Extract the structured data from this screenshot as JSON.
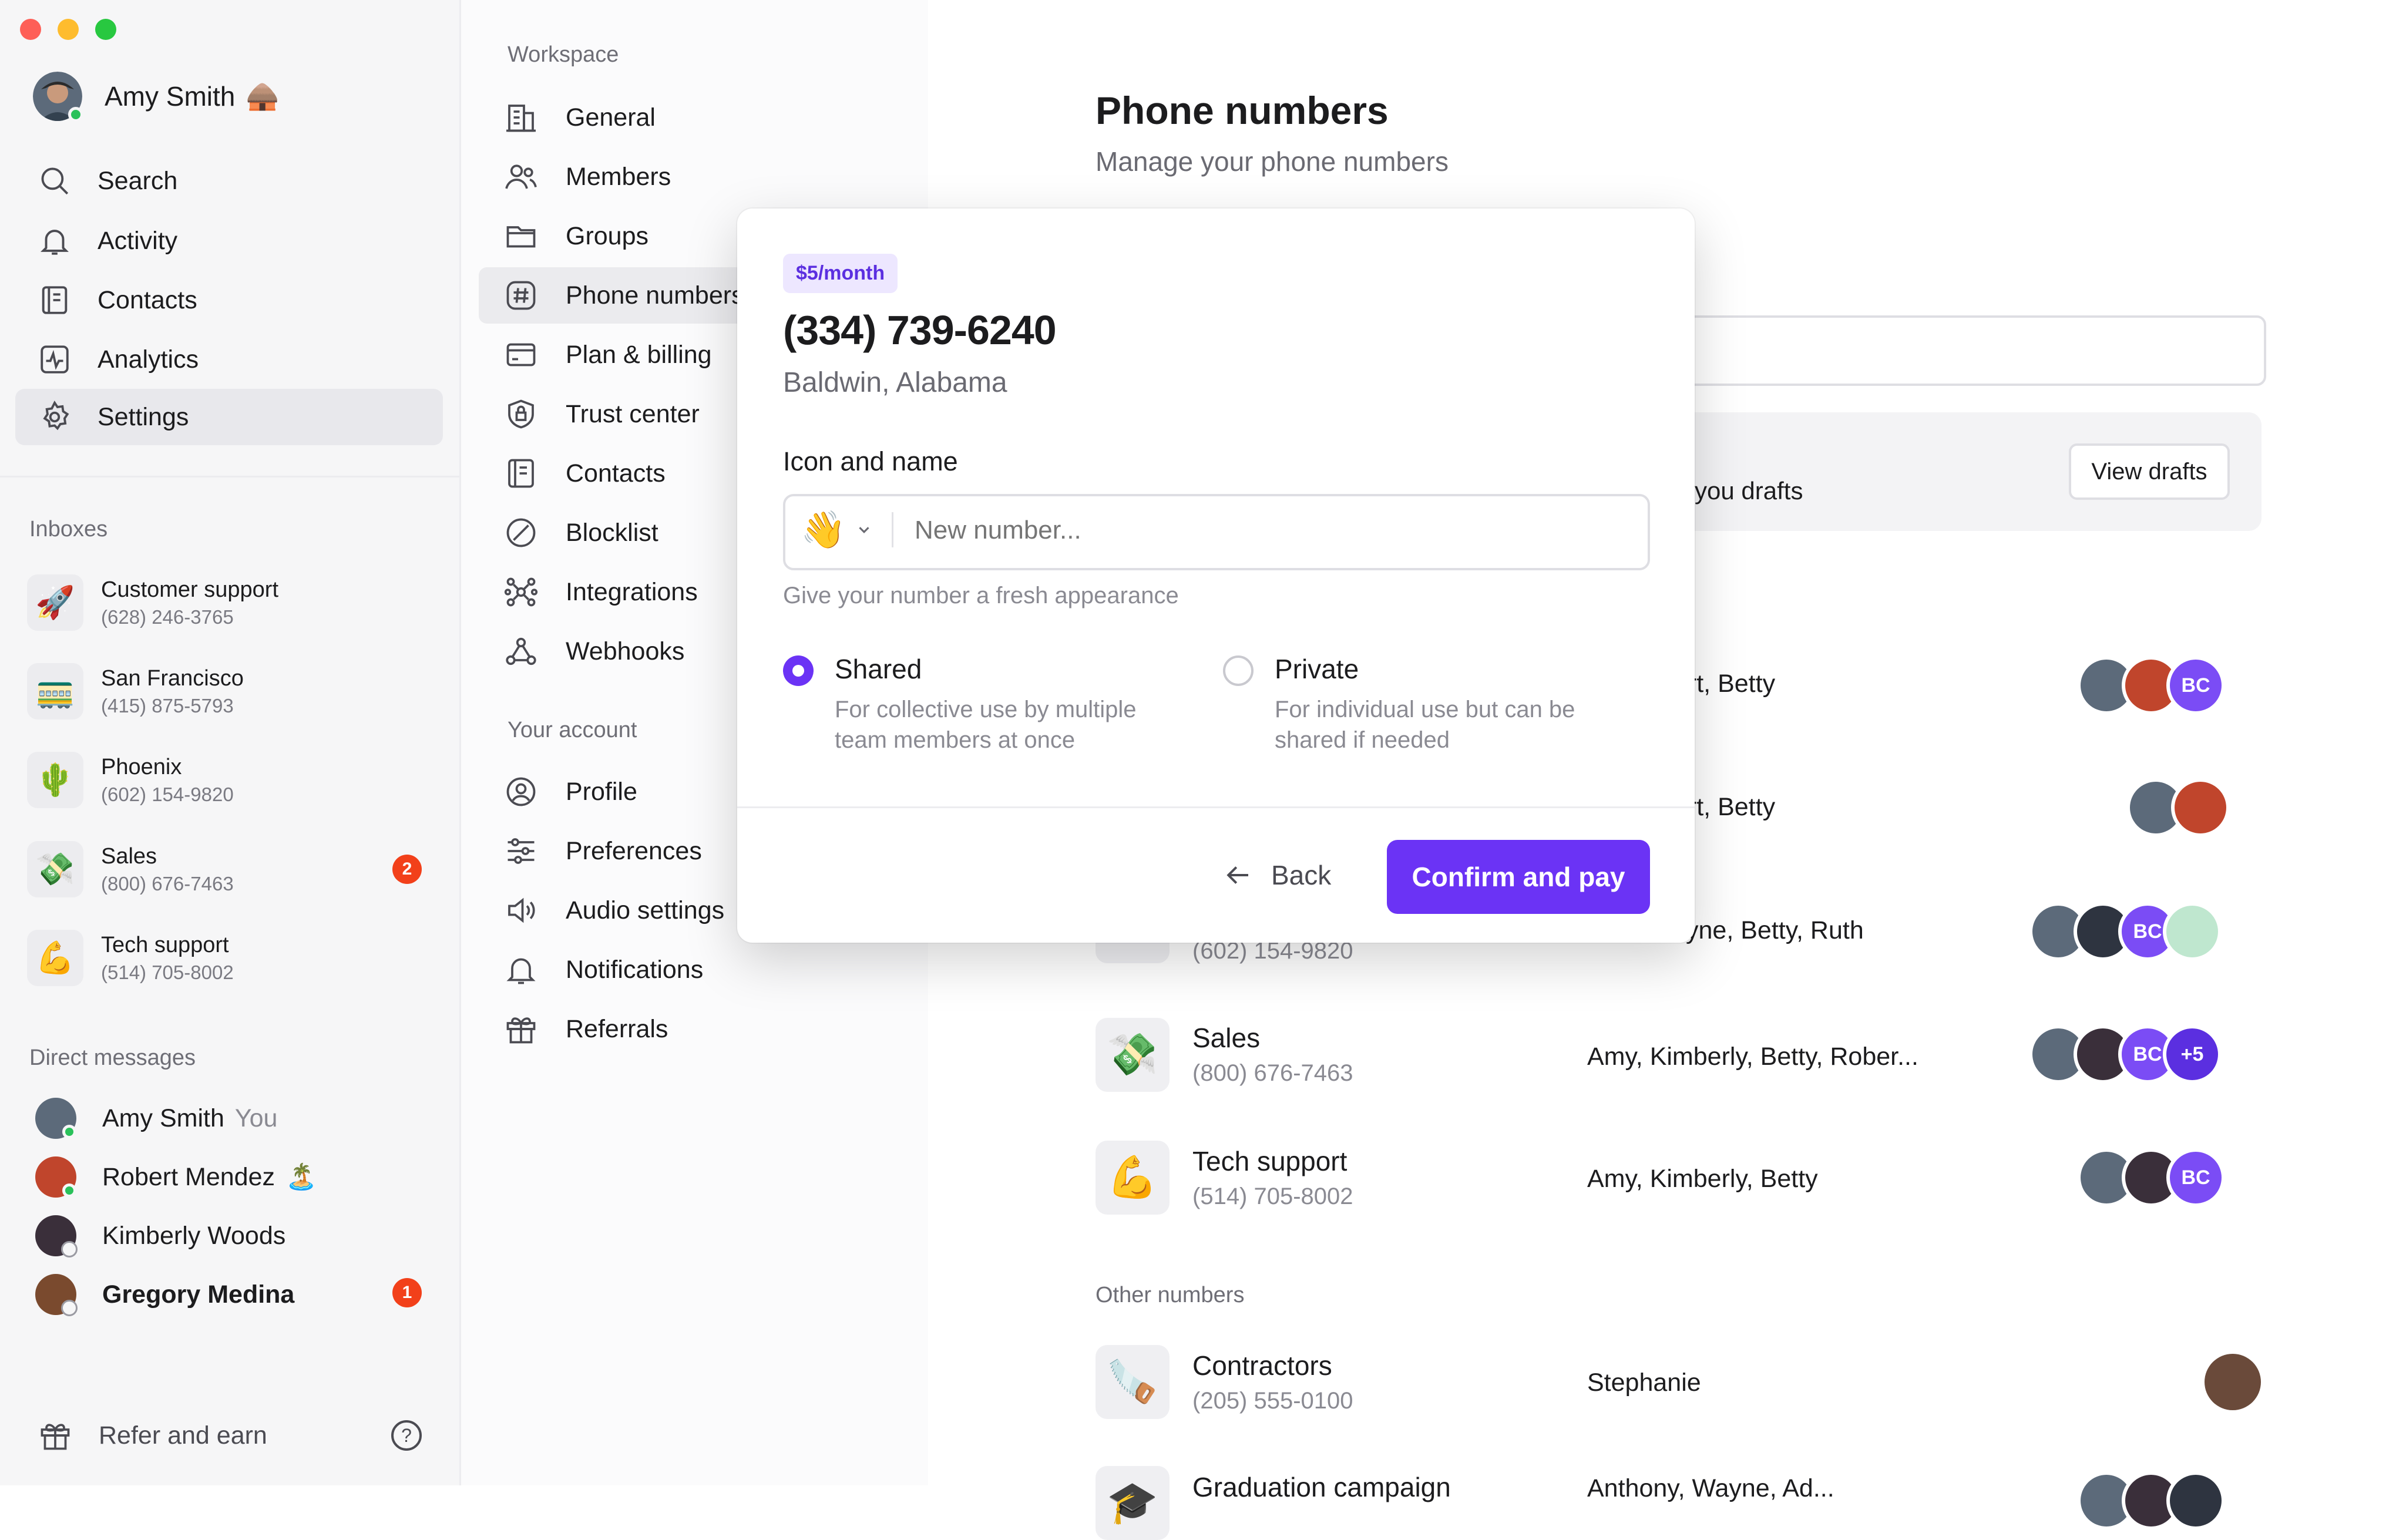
{
  "window": {
    "controls": [
      "close",
      "minimize",
      "maximize"
    ]
  },
  "user": {
    "name": "Amy Smith",
    "status_emoji": "🛖"
  },
  "sidebar": {
    "nav": [
      {
        "label": "Search",
        "icon": "search-icon"
      },
      {
        "label": "Activity",
        "icon": "bell-icon"
      },
      {
        "label": "Contacts",
        "icon": "contacts-icon"
      },
      {
        "label": "Analytics",
        "icon": "analytics-icon"
      },
      {
        "label": "Settings",
        "icon": "gear-icon",
        "active": true
      }
    ],
    "inboxes_label": "Inboxes",
    "inboxes": [
      {
        "emoji": "🚀",
        "name": "Customer support",
        "phone": "(628) 246-3765"
      },
      {
        "emoji": "🚃",
        "name": "San Francisco",
        "phone": "(415) 875-5793"
      },
      {
        "emoji": "🌵",
        "name": "Phoenix",
        "phone": "(602) 154-9820"
      },
      {
        "emoji": "💸",
        "name": "Sales",
        "phone": "(800) 676-7463",
        "badge": "2"
      },
      {
        "emoji": "💪",
        "name": "Tech support",
        "phone": "(514) 705-8002"
      }
    ],
    "dm_label": "Direct messages",
    "dms": [
      {
        "name": "Amy Smith",
        "suffix": "You"
      },
      {
        "name": "Robert Mendez",
        "suffix": "🏝️"
      },
      {
        "name": "Kimberly Woods",
        "suffix": ""
      },
      {
        "name": "Gregory Medina",
        "suffix": "",
        "badge": "1"
      }
    ],
    "refer": "Refer and earn"
  },
  "settings_nav": {
    "workspace_label": "Workspace",
    "workspace": [
      {
        "label": "General",
        "icon": "building-icon"
      },
      {
        "label": "Members",
        "icon": "members-icon"
      },
      {
        "label": "Groups",
        "icon": "folder-icon"
      },
      {
        "label": "Phone numbers",
        "icon": "hash-icon",
        "active": true
      },
      {
        "label": "Plan & billing",
        "icon": "credit-card-icon"
      },
      {
        "label": "Trust center",
        "icon": "shield-icon"
      },
      {
        "label": "Contacts",
        "icon": "contacts-icon"
      },
      {
        "label": "Blocklist",
        "icon": "block-icon"
      },
      {
        "label": "Integrations",
        "icon": "integrations-icon"
      },
      {
        "label": "Webhooks",
        "icon": "webhooks-icon"
      }
    ],
    "account_label": "Your account",
    "account": [
      {
        "label": "Profile",
        "icon": "profile-icon"
      },
      {
        "label": "Preferences",
        "icon": "sliders-icon"
      },
      {
        "label": "Audio settings",
        "icon": "speaker-icon"
      },
      {
        "label": "Notifications",
        "icon": "bell-icon"
      },
      {
        "label": "Referrals",
        "icon": "gift-icon"
      }
    ]
  },
  "main": {
    "title": "Phone numbers",
    "subtitle": "Manage your phone numbers",
    "drafts_text": "n you drafts",
    "view_drafts": "View drafts",
    "rows": [
      {
        "members": "ert, Betty",
        "avatars": [
          "A",
          "R",
          "BC"
        ]
      },
      {
        "members": "ert, Betty",
        "avatars": [
          "A",
          "R"
        ]
      },
      {
        "name": "",
        "phone": "(602) 154-9820",
        "members": "Amy, Wayne, Betty, Ruth",
        "members_visible": "yne, Betty, Ruth",
        "avatars": [
          "A",
          "W",
          "BC",
          "R"
        ]
      },
      {
        "emoji": "💸",
        "name": "Sales",
        "phone": "(800) 676-7463",
        "members": "Amy, Kimberly, Betty, Rober...",
        "avatars": [
          "A",
          "K",
          "BC",
          "+5"
        ]
      },
      {
        "emoji": "💪",
        "name": "Tech support",
        "phone": "(514) 705-8002",
        "members": "Amy, Kimberly, Betty",
        "avatars": [
          "A",
          "K",
          "BC"
        ]
      }
    ],
    "other_label": "Other numbers",
    "other_rows": [
      {
        "emoji": "🪚",
        "name": "Contractors",
        "phone": "(205) 555-0100",
        "members": "Stephanie"
      },
      {
        "emoji": "🎓",
        "name": "Graduation campaign",
        "phone": "",
        "members": "Anthony, Wayne, Ad..."
      }
    ]
  },
  "modal": {
    "price": "$5/month",
    "phone": "(334) 739-6240",
    "location": "Baldwin, Alabama",
    "icon_label": "Icon and name",
    "emoji": "👋",
    "name_placeholder": "New number...",
    "hint": "Give your number a fresh appearance",
    "options": [
      {
        "title": "Shared",
        "desc1": "For collective use by multiple",
        "desc2": "team members at once",
        "selected": true
      },
      {
        "title": "Private",
        "desc1": "For individual use but can be",
        "desc2": "shared if needed",
        "selected": false
      }
    ],
    "back": "Back",
    "confirm": "Confirm and pay"
  },
  "colors": {
    "accent": "#6b33f5",
    "badge": "#f2401a",
    "online": "#2ac15a",
    "bc_avatar": "#7b4cf5"
  }
}
